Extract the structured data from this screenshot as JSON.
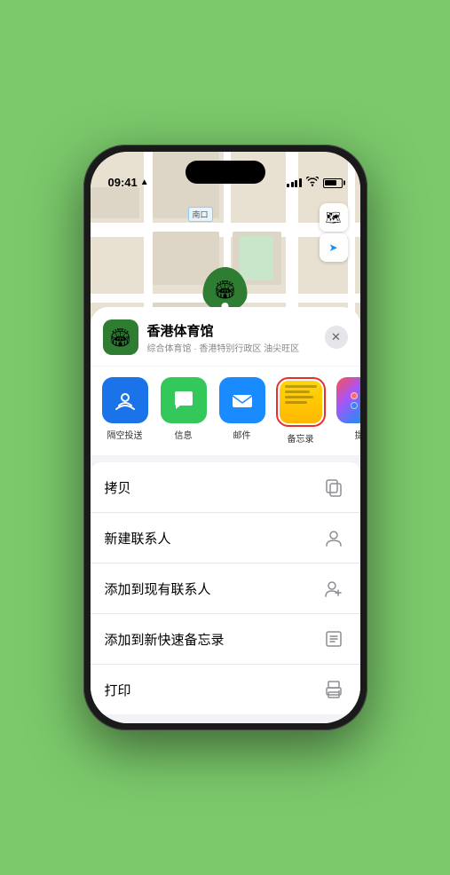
{
  "status_bar": {
    "time": "09:41",
    "location_arrow": "▲"
  },
  "map": {
    "label_text": "南口",
    "map_type_btn": "🗺",
    "location_btn": "➤"
  },
  "pin": {
    "label": "香港体育馆",
    "emoji": "🏟"
  },
  "sheet": {
    "venue_name": "香港体育馆",
    "venue_sub": "综合体育馆 · 香港特别行政区 油尖旺区",
    "close_btn": "✕"
  },
  "share_items": [
    {
      "id": "airdrop",
      "label": "隔空投送",
      "type": "airdrop"
    },
    {
      "id": "messages",
      "label": "信息",
      "type": "messages"
    },
    {
      "id": "mail",
      "label": "邮件",
      "type": "mail"
    },
    {
      "id": "notes",
      "label": "备忘录",
      "type": "notes",
      "highlighted": true
    },
    {
      "id": "more",
      "label": "提",
      "type": "more"
    }
  ],
  "actions": [
    {
      "id": "copy",
      "label": "拷贝",
      "icon": "copy"
    },
    {
      "id": "new-contact",
      "label": "新建联系人",
      "icon": "person"
    },
    {
      "id": "add-existing",
      "label": "添加到现有联系人",
      "icon": "person-add"
    },
    {
      "id": "quick-note",
      "label": "添加到新快速备忘录",
      "icon": "notes"
    },
    {
      "id": "print",
      "label": "打印",
      "icon": "printer"
    }
  ],
  "icons": {
    "copy": "⎘",
    "person": "👤",
    "person-add": "👤",
    "notes": "📋",
    "printer": "🖨"
  }
}
